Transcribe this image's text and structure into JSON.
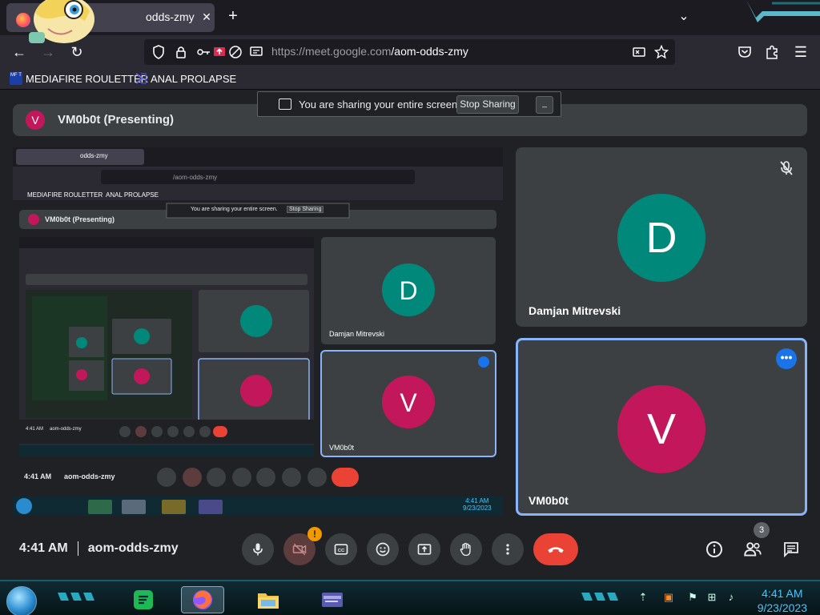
{
  "browser": {
    "tab_title": "odds-zmy",
    "close_symbol": "✕",
    "new_tab_symbol": "+",
    "url_host": "https://meet.google.com",
    "url_path": "/aom-odds-zmy",
    "bookmarks": [
      {
        "label": "MEDIAFIRE ROULETTER",
        "icon_text": "MF T"
      },
      {
        "label": "ANAL PROLAPSE"
      }
    ]
  },
  "share_notice": {
    "text": "You are sharing your entire screen.",
    "stop_label": "Stop Sharing",
    "minimize_symbol": "_"
  },
  "presenting": {
    "avatar_letter": "V",
    "title": "VM0b0t (Presenting)"
  },
  "participants": [
    {
      "name": "Damjan Mitrevski",
      "letter": "D",
      "color": "#00897b",
      "muted": true
    },
    {
      "name": "VM0b0t",
      "letter": "V",
      "color": "#c2185b",
      "active": true
    }
  ],
  "meeting": {
    "time": "4:41 AM",
    "code": "aom-odds-zmy",
    "people_count": "3",
    "camera_alert": "!"
  },
  "taskbar": {
    "clock_time": "4:41 AM",
    "clock_date": "9/23/2023",
    "apps": [
      "spotify-icon",
      "firefox-icon",
      "file-explorer-icon",
      "media-player-icon"
    ]
  },
  "colors": {
    "accent_blue": "#8ab4f8",
    "end_call_red": "#ea4335",
    "teal_avatar": "#00897b",
    "magenta_avatar": "#c2185b"
  }
}
